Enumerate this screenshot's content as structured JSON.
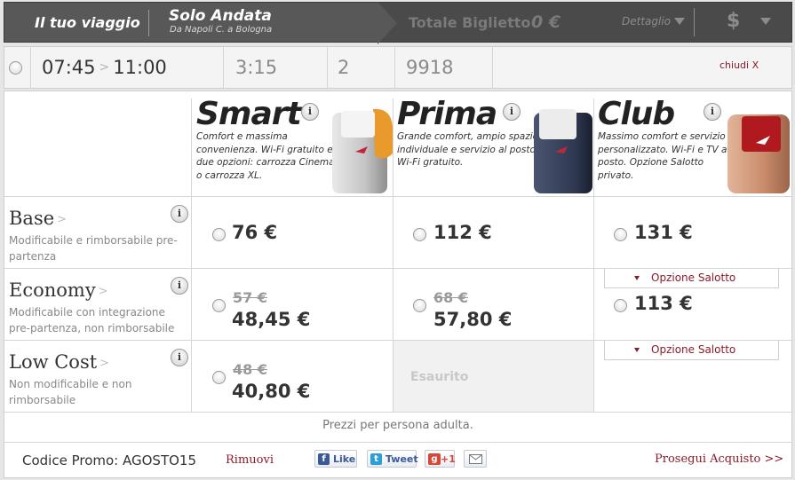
{
  "header": {
    "trip_label": "Il tuo viaggio",
    "trip_type": "Solo Andata",
    "route": "Da Napoli C. a Bologna",
    "total_label": "Totale Biglietto",
    "total_value": "0 €",
    "detail_label": "Dettaglio",
    "currency_symbol": "$"
  },
  "train": {
    "departure": "07:45",
    "arrival": "11:00",
    "arrow": ">",
    "duration": "3:15",
    "changes": "2",
    "train_number": "9918",
    "close_label": "chiudi X"
  },
  "classes": [
    {
      "name": "Smart",
      "info": "i",
      "description": "Comfort e massima convenienza. Wi-Fi gratuito e due opzioni: carrozza Cinema o carrozza XL.",
      "icon": "seat-smart-image"
    },
    {
      "name": "Prima",
      "info": "i",
      "description": "Grande comfort, ampio spazio individuale e servizio al posto. Wi-Fi gratuito.",
      "icon": "seat-prima-image"
    },
    {
      "name": "Club",
      "info": "i",
      "description": "Massimo comfort e servizio personalizzato. Wi-Fi e TV al posto. Opzione Salotto privato.",
      "icon": "seat-club-image"
    }
  ],
  "fares": [
    {
      "name": "Base",
      "chevron": ">",
      "info": "i",
      "description": "Modificabile e rimborsabile pre-partenza",
      "smart": {
        "price": "76 €"
      },
      "prima": {
        "price": "112 €"
      },
      "club": {
        "price": "131 €"
      }
    },
    {
      "name": "Economy",
      "chevron": ">",
      "info": "i",
      "description": "Modificabile con integrazione pre-partenza, non rimborsabile",
      "smart": {
        "old_price": "57 €",
        "price": "48,45 €"
      },
      "prima": {
        "old_price": "68 €",
        "price": "57,80 €"
      },
      "club": {
        "price": "113 €"
      }
    },
    {
      "name": "Low Cost",
      "chevron": ">",
      "info": "i",
      "description": "Non modificabile e non rimborsabile",
      "smart": {
        "old_price": "48 €",
        "price": "40,80 €"
      },
      "prima": {
        "status": "Esaurito"
      }
    }
  ],
  "salotto_option_label": "Opzione Salotto",
  "note": "Prezzi per persona adulta.",
  "footer": {
    "promo_label": "Codice Promo: AGOSTO15",
    "remove_label": "Rimuovi",
    "facebook_label": "Like",
    "twitter_label": "Tweet",
    "gplus_label": "+1",
    "continue_label": "Prosegui Acquisto >>"
  },
  "colors": {
    "header_bg": "#585858",
    "accent_link": "#8b1a2b",
    "panel_bg": "#ffffff",
    "sold_out_bg": "#f1f1f1"
  }
}
